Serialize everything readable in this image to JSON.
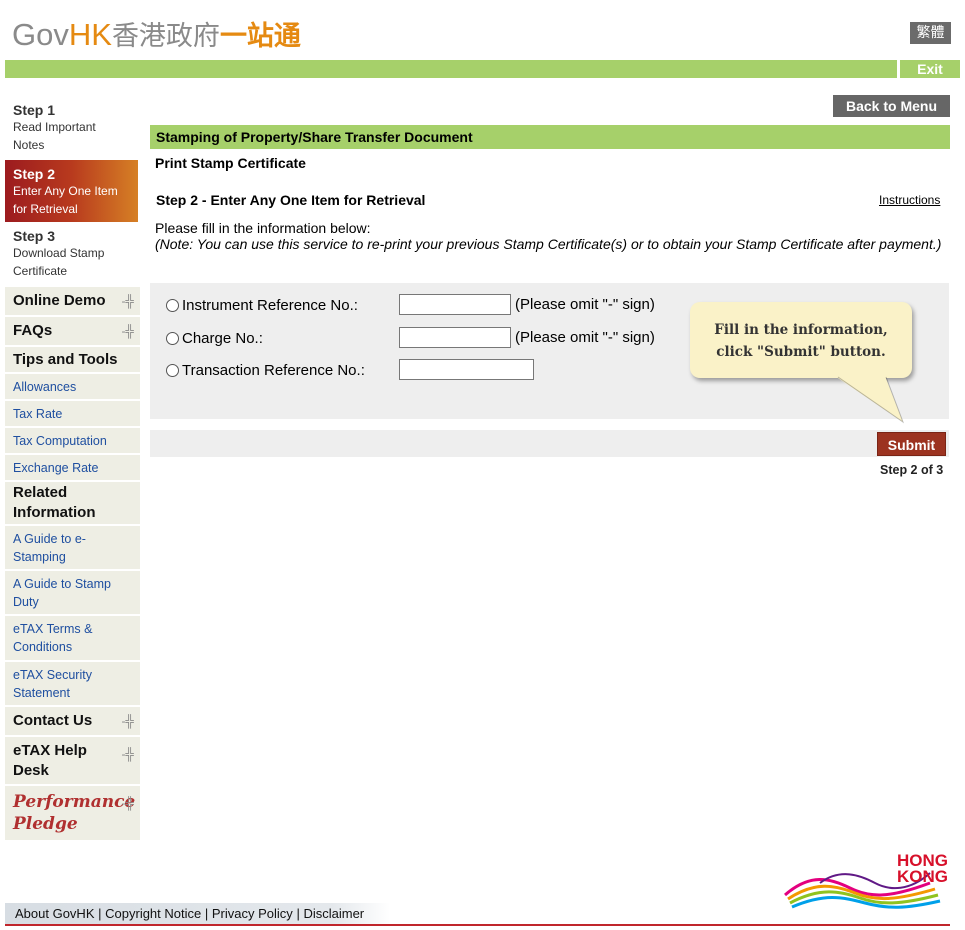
{
  "header": {
    "logo_gov": "Gov",
    "logo_hk": "HK",
    "logo_zh_grey": "香港政府",
    "logo_zh_orange": "一站通",
    "lang_button": "繁體",
    "exit_button": "Exit"
  },
  "sidebar": {
    "steps": [
      {
        "title": "Step 1",
        "desc": "Read Important Notes"
      },
      {
        "title": "Step 2",
        "desc": "Enter Any One Item for Retrieval"
      },
      {
        "title": "Step 3",
        "desc": "Download Stamp Certificate"
      }
    ],
    "items": {
      "online_demo": "Online Demo",
      "faqs": "FAQs",
      "tips_tools": "Tips and Tools",
      "allowances": "Allowances",
      "tax_rate": "Tax Rate",
      "tax_computation": "Tax Computation",
      "exchange_rate": "Exchange Rate",
      "related_info": "Related Information",
      "guide_estamping": "A Guide to e-Stamping",
      "guide_stamp_duty": "A Guide to Stamp Duty",
      "etax_terms": "eTAX Terms & Conditions",
      "etax_security": "eTAX Security Statement",
      "contact_us": "Contact Us",
      "etax_help": "eTAX Help Desk",
      "performance_pledge": "Performance Pledge"
    }
  },
  "main": {
    "back_button": "Back to Menu",
    "section_title": "Stamping of Property/Share Transfer Document",
    "sub_title": "Print Stamp Certificate",
    "step_heading": "Step 2 - Enter Any One Item for Retrieval",
    "instructions_link": "Instructions",
    "fill_text": "Please fill in the information below:",
    "note_text": "(Note: You can use this service to re-print your previous Stamp Certificate(s) or to obtain your Stamp Certificate after payment.)",
    "form": {
      "instrument_label": "Instrument Reference No.:",
      "instrument_hint": "(Please omit \"-\" sign)",
      "charge_label": "Charge No.:",
      "charge_hint": "(Please omit \"-\" sign)",
      "transaction_label": "Transaction Reference No.:"
    },
    "tooltip_line1": "Fill in the information,",
    "tooltip_line2": "click \"Submit\" button.",
    "submit_button": "Submit",
    "step_count": "Step 2 of 3"
  },
  "footer": {
    "links": [
      "About GovHK",
      "Copyright Notice",
      "Privacy Policy",
      "Disclaimer"
    ],
    "separator": "|",
    "logo_line1": "HONG",
    "logo_line2": "KONG"
  }
}
